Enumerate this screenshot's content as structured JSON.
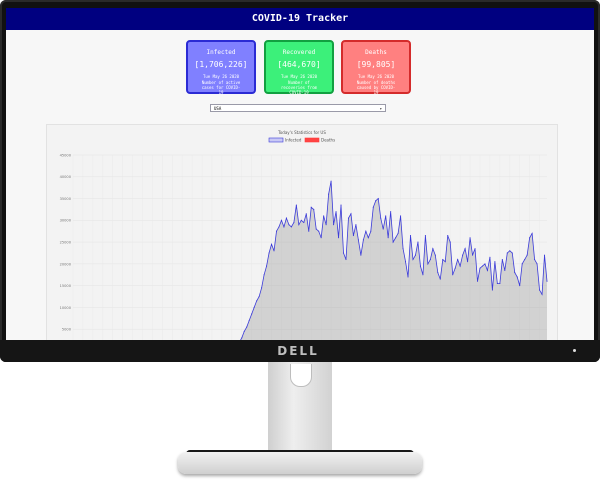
{
  "app": {
    "title": "COVID-19 Tracker"
  },
  "monitor": {
    "brand": "DELL"
  },
  "cards": [
    {
      "title": "Infected",
      "count": "[1,706,226]",
      "date": "Tue May 26 2020",
      "desc": "Number of active cases for COVID-19",
      "color": "#8080ff"
    },
    {
      "title": "Recovered",
      "count": "[464,670]",
      "date": "Tue May 26 2020",
      "desc": "Number of recoveries from COVID-19",
      "color": "#3cf07a"
    },
    {
      "title": "Deaths",
      "count": "[99,805]",
      "date": "Tue May 26 2020",
      "desc": "Number of deaths caused by COVID-19",
      "color": "#ff8080"
    }
  ],
  "country_select": {
    "value": "USA"
  },
  "chart_data": {
    "type": "line",
    "title": "Today's Statistics for US",
    "legend": [
      "Infected",
      "Deaths"
    ],
    "legend_position": "top",
    "grid": true,
    "ylim": [
      0,
      45000
    ],
    "yticks": [
      5000,
      10000,
      15000,
      20000,
      25000,
      30000,
      35000,
      40000,
      45000
    ],
    "series": [
      {
        "name": "Infected",
        "color": "#3b3bd9",
        "values": [
          0,
          0,
          0,
          0,
          0,
          0,
          0,
          0,
          0,
          0,
          0,
          0,
          0,
          0,
          0,
          0,
          0,
          0,
          0,
          0,
          0,
          0,
          0,
          0,
          0,
          0,
          0,
          0,
          0,
          0,
          0,
          0,
          0,
          0,
          0,
          0,
          0,
          0,
          0,
          0,
          0,
          0,
          0,
          0,
          0,
          0,
          0,
          0,
          0,
          0,
          0,
          0,
          0,
          0,
          0,
          0,
          0,
          0,
          0,
          0,
          0,
          0,
          0,
          0,
          200,
          1000,
          1500,
          2000,
          3000,
          4500,
          5500,
          7000,
          8500,
          10000,
          11500,
          12500,
          14500,
          17500,
          19500,
          22500,
          24500,
          23000,
          27500,
          28500,
          30000,
          28500,
          30500,
          29000,
          28500,
          29500,
          33500,
          29000,
          30000,
          29500,
          31500,
          27500,
          33000,
          32500,
          28000,
          27500,
          26000,
          31000,
          29000,
          36000,
          39000,
          29000,
          32000,
          26000,
          33500,
          22500,
          21000,
          30500,
          31500,
          26500,
          29000,
          25500,
          22000,
          25500,
          27500,
          26000,
          27500,
          33000,
          34500,
          35000,
          30500,
          28000,
          31000,
          26000,
          32000,
          25000,
          26000,
          27000,
          31000,
          23500,
          20500,
          17000,
          26500,
          21000,
          22000,
          25000,
          19500,
          17500,
          26500,
          20000,
          21000,
          23500,
          22000,
          18000,
          16500,
          21000,
          20500,
          26500,
          25000,
          17500,
          19000,
          21000,
          19500,
          22000,
          23500,
          20500,
          26000,
          22000,
          23500,
          16000,
          19000,
          19500,
          20000,
          18500,
          21500,
          14000,
          20500,
          15500,
          15500,
          21000,
          18500,
          22500,
          23000,
          22500,
          18000,
          17000,
          15000,
          20000,
          21000,
          22000,
          26000,
          27000,
          21000,
          20000,
          14000,
          13000,
          22000,
          16000
        ]
      },
      {
        "name": "Deaths",
        "color": "#ff3b3b",
        "values": [
          0,
          0,
          0,
          0,
          0,
          0,
          0,
          0,
          0,
          0,
          0,
          0,
          0,
          0,
          0,
          0,
          0,
          0,
          0,
          0,
          0,
          0,
          0,
          0,
          0,
          0,
          0,
          0,
          0,
          0,
          0,
          0,
          0,
          0,
          0,
          0,
          0,
          0,
          0,
          0,
          0,
          0,
          0,
          0,
          0,
          0,
          0,
          0,
          0,
          0,
          0,
          0,
          0,
          0,
          0,
          0,
          0,
          0,
          0,
          0,
          0,
          0,
          0,
          0,
          0,
          0,
          0,
          0,
          0,
          0,
          0,
          0,
          0,
          0,
          0,
          0,
          0,
          0,
          0,
          0,
          0,
          0,
          0,
          0,
          0,
          0,
          0,
          0,
          0,
          0,
          0,
          0,
          0,
          0,
          0,
          0,
          0,
          0,
          0,
          0,
          0,
          0,
          0,
          0,
          0,
          0,
          0,
          0,
          0,
          0,
          0,
          0,
          0,
          0,
          0,
          0,
          0,
          0,
          0,
          0,
          0,
          0,
          0,
          0,
          0,
          0,
          0,
          0,
          0,
          0,
          0,
          0,
          0,
          0,
          0,
          0,
          1200,
          1800,
          2000,
          1500,
          1000,
          800,
          400,
          0,
          0,
          0,
          0,
          0,
          0,
          0,
          0,
          0,
          0,
          0,
          0,
          0,
          0,
          0,
          0,
          0,
          0,
          0,
          0,
          0,
          0,
          0,
          0,
          0,
          0,
          0,
          0,
          0,
          0,
          0,
          0,
          0,
          0,
          0,
          0,
          0,
          0,
          0,
          0,
          0,
          0,
          0,
          0,
          0,
          0,
          0,
          0,
          0
        ]
      }
    ]
  }
}
